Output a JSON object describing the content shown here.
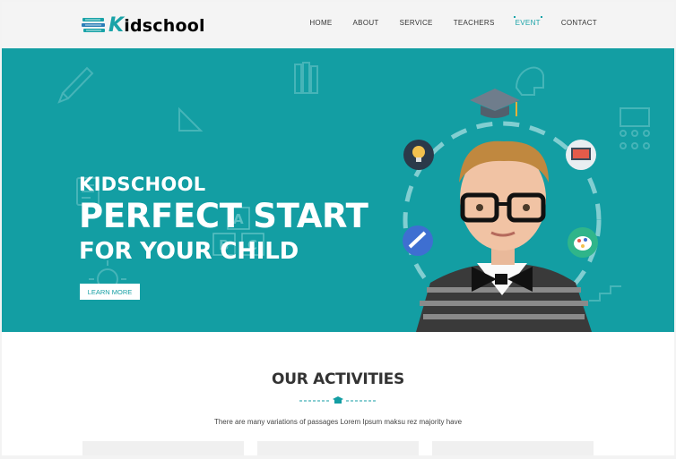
{
  "header": {
    "logo": {
      "initial": "K",
      "rest": "idschool"
    },
    "nav": [
      "HOME",
      "ABOUT",
      "SERVICE",
      "TEACHERS",
      "EVENT",
      "CONTACT"
    ],
    "active_nav": "EVENT"
  },
  "hero": {
    "small_title": "KIDSCHOOL",
    "big_title": "PERFECT START",
    "sub_title": "FOR YOUR CHILD",
    "button": "LEARN MORE",
    "deco_letters": [
      "A",
      "B",
      "C"
    ],
    "slides": 3,
    "active_slide": 0
  },
  "activities": {
    "title": "OUR ACTIVITIES",
    "description": "There are many variations of passages Lorem Ipsum maksu rez majority have"
  },
  "colors": {
    "accent": "#139ea3",
    "hero_bg": "#139ea3",
    "header_bg": "#f4f4f4"
  }
}
